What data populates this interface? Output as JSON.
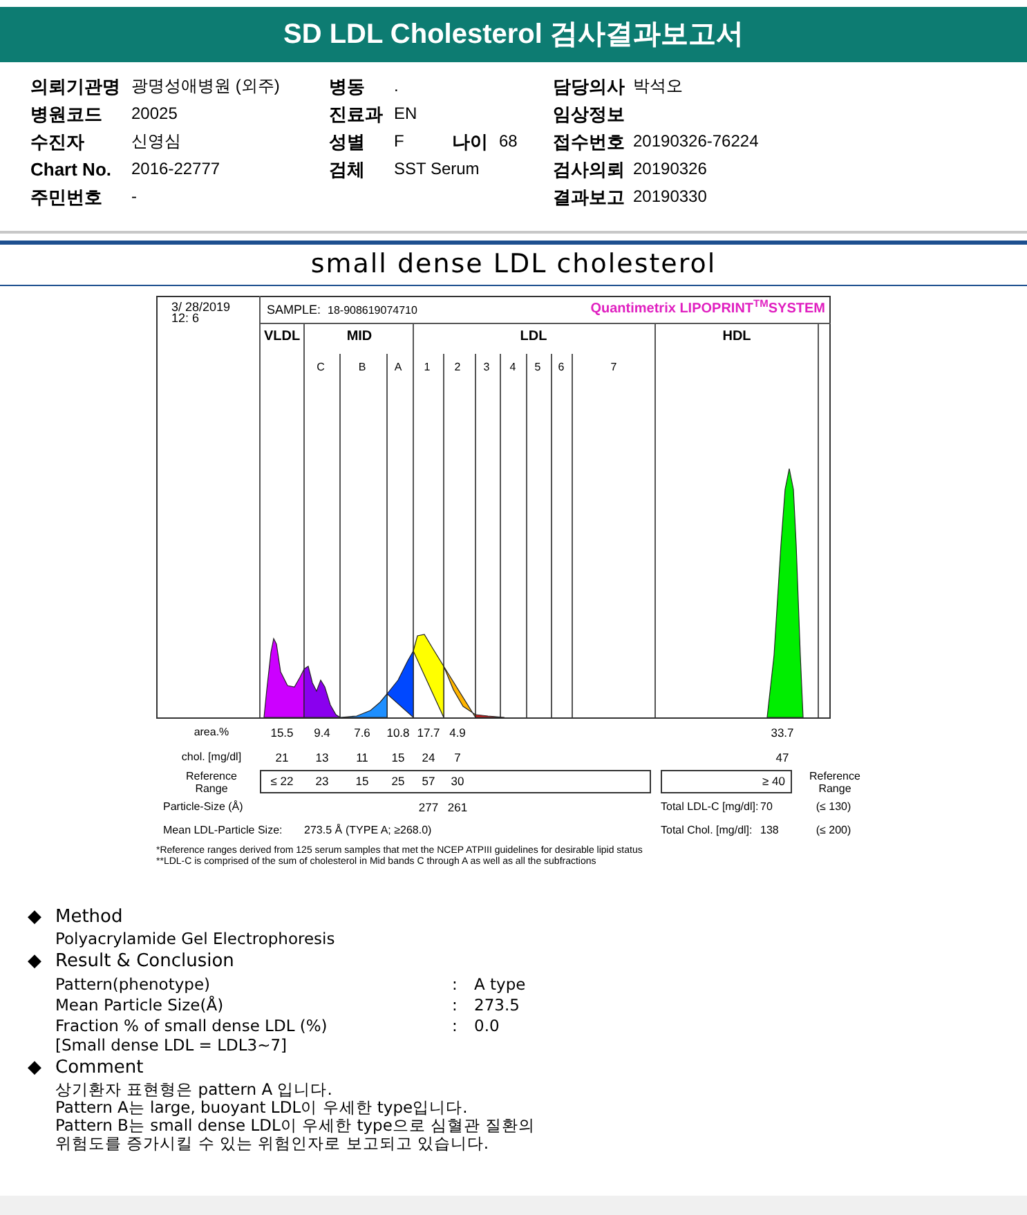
{
  "report_title": "SD LDL Cholesterol 검사결과보고서",
  "patient_info": [
    {
      "left": {
        "label": "의뢰기관명",
        "value": "광명성애병원 (외주)"
      },
      "middle": [
        {
          "label": "병동",
          "value": "."
        }
      ],
      "right": {
        "label": "담당의사",
        "value": "박석오"
      }
    },
    {
      "left": {
        "label": "병원코드",
        "value": "20025"
      },
      "middle": [
        {
          "label": "진료과",
          "value": "EN"
        }
      ],
      "right": {
        "label": "임상정보"
      }
    },
    {
      "left": {
        "label": "수진자",
        "value": "신영심"
      },
      "middle": [
        {
          "label": "성별",
          "value": "F"
        },
        {
          "label": "나이",
          "value": "68"
        }
      ],
      "right": {
        "label": "접수번호",
        "value": "20190326-76224"
      }
    },
    {
      "left": {
        "label": "Chart No.",
        "value": "2016-22777"
      },
      "middle": [
        {
          "label": "검체",
          "value": "SST Serum"
        }
      ],
      "right": {
        "label": "검사의뢰",
        "value": "20190326"
      }
    },
    {
      "left": {
        "label": "주민번호",
        "value": "-"
      },
      "right": {
        "label": "결과보고",
        "value": "20190330"
      }
    }
  ],
  "section_title": "small dense LDL cholesterol",
  "electropherogram": {
    "date": "3/ 28/2019",
    "time": "12: 6",
    "sample_label": "SAMPLE:",
    "sample_id": "18-908619074710",
    "brand": "Quantimetrix LIPOPRINT$^{TM}$SYSTEM",
    "groups": [
      "VLDL",
      "MID",
      "LDL",
      "HDL"
    ],
    "bands": [
      "C",
      "B",
      "A",
      "1",
      "2",
      "3",
      "4",
      "5",
      "6",
      "7"
    ],
    "rows": [
      {
        "label": "area.%",
        "values": [
          "15.5",
          "9.4",
          "7.6",
          "10.8",
          "17.7",
          "4.9"
        ],
        "hdl": "33.7"
      },
      {
        "label": "chol. [mg/dl]",
        "values": [
          "21",
          "13",
          "11",
          "15",
          "24",
          "7"
        ],
        "hdl": "47"
      }
    ],
    "reference": {
      "label": "Reference Range",
      "values": [
        "≤ 22",
        "23",
        "15",
        "25",
        "57",
        "30"
      ],
      "hdl": "≥ 40",
      "right_label": "Reference Range"
    },
    "particle_size": {
      "label": "Particle-Size (Å)",
      "values": [
        "277",
        "261"
      ]
    },
    "mean": {
      "label": "Mean LDL-Particle Size:",
      "value": "273.5 Å",
      "note": "(TYPE A; ≥268.0)"
    },
    "totals": [
      {
        "label": "Total LDL-C [mg/dl]:",
        "value": "70",
        "range": "(≤ 130)"
      },
      {
        "label": "Total Chol. [mg/dl]:",
        "value": "138",
        "range": "(≤ 200)"
      }
    ],
    "footnotes": [
      "*Reference ranges derived from 125 serum samples that met the NCEP ATPIII guidelines for desirable lipid status",
      "**LDL-C is comprised of the sum of cholesterol in Mid bands C through A as well as all the subfractions"
    ]
  },
  "sections": [
    {
      "bullet": "◆",
      "heading": "Method",
      "lines": [
        "Polyacrylamide Gel Electrophoresis"
      ]
    },
    {
      "bullet": "◆",
      "heading": "Result & Conclusion",
      "results": [
        {
          "label": "Pattern(phenotype)",
          "separator": ":",
          "value": "A type"
        },
        {
          "label": "Mean Particle Size(Å)",
          "separator": ":",
          "value": "273.5"
        },
        {
          "label": "Fraction % of small dense LDL (%)",
          "separator": ":",
          "value": "0.0"
        }
      ],
      "lines": [
        "[Small dense LDL = LDL3~7]"
      ]
    },
    {
      "bullet": "◆",
      "heading": "Comment",
      "lines": [
        "상기환자 표현형은 pattern A 입니다.",
        "Pattern A는 large, buoyant LDL이 우세한 type입니다.",
        "Pattern B는 small dense LDL이 우세한 type으로 심혈관 질환의",
        "위험도를 증가시킬 수 있는 위험인자로 보고되고 있습니다."
      ]
    }
  ]
}
